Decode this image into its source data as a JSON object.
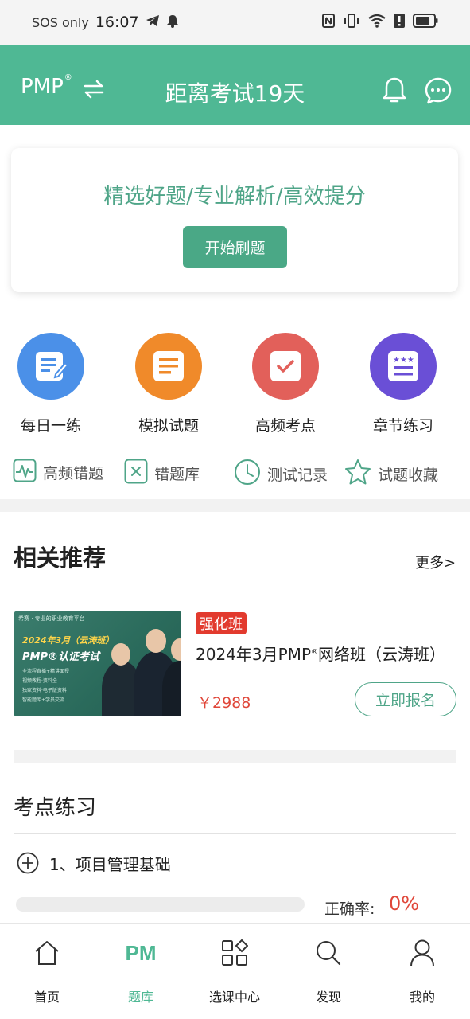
{
  "status_bar": {
    "carrier": "SOS only",
    "time": "16:07"
  },
  "header": {
    "brand": "PMP",
    "brand_mark": "®",
    "title": "距离考试19天",
    "bg_color": "#4fb894"
  },
  "banner": {
    "text": "精选好题/专业解析/高效提分",
    "button": "开始刷题"
  },
  "features": [
    {
      "label": "每日一练",
      "icon": "edit-note-icon",
      "color": "#4b90e8"
    },
    {
      "label": "模拟试题",
      "icon": "document-icon",
      "color": "#f08a2a"
    },
    {
      "label": "高频考点",
      "icon": "check-square-icon",
      "color": "#e2605a"
    },
    {
      "label": "章节练习",
      "icon": "list-icon",
      "color": "#6a4fd6"
    }
  ],
  "sub_features": [
    {
      "label": "高频错题",
      "icon": "waveform-icon"
    },
    {
      "label": "错题库",
      "icon": "x-box-icon"
    },
    {
      "label": "测试记录",
      "icon": "clock-icon"
    },
    {
      "label": "试题收藏",
      "icon": "star-icon"
    }
  ],
  "recommend": {
    "title": "相关推荐",
    "more": "更多>",
    "course": {
      "image_text": {
        "org": "希赛 · 专业的职业教育平台",
        "date": "2024年3月（云涛班）",
        "title": "PMP®认证考试",
        "bullets": [
          "全流程直播+精讲面授",
          "视频教程·资料全",
          "独家资料·电子版资料",
          "智能题库+学员交流"
        ]
      },
      "tag": "强化班",
      "name": "2024年3月PMP",
      "name_mark": "®",
      "name_suffix": "网络班（云涛班）",
      "price": "￥2988",
      "button": "立即报名"
    }
  },
  "practice": {
    "title": "考点练习",
    "topics": [
      {
        "label": "1、项目管理基础",
        "rate_label": "正确率:",
        "rate": "0%",
        "progress": 0
      }
    ]
  },
  "bottom_nav": [
    {
      "label": "首页",
      "icon": "home-icon",
      "active": false
    },
    {
      "label": "题库",
      "icon": "pm-icon",
      "icon_text": "PM",
      "active": true
    },
    {
      "label": "选课中心",
      "icon": "apps-icon",
      "active": false
    },
    {
      "label": "发现",
      "icon": "search-icon",
      "active": false
    },
    {
      "label": "我的",
      "icon": "user-icon",
      "active": false
    }
  ]
}
